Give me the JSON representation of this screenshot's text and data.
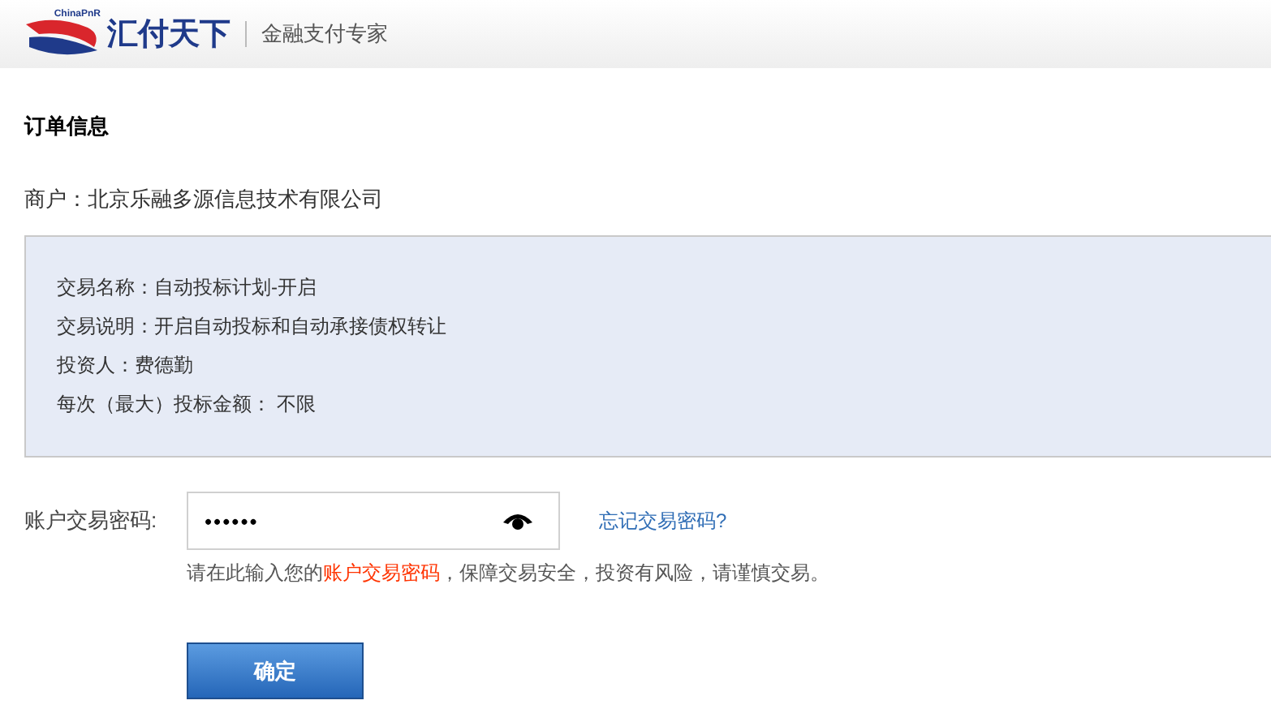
{
  "header": {
    "logo_small": "ChinaPnR",
    "brand": "汇付天下",
    "slogan": "金融支付专家"
  },
  "order": {
    "title": "订单信息",
    "merchant": "商户：北京乐融多源信息技术有限公司",
    "details": [
      "交易名称：自动投标计划-开启",
      "交易说明：开启自动投标和自动承接债权转让",
      "投资人：费德勤",
      "每次（最大）投标金额： 不限"
    ]
  },
  "password": {
    "label": "账户交易密码:",
    "value": "••••••",
    "forgot_link": "忘记交易密码?",
    "hint": [
      {
        "text": "请在此输入您的",
        "highlight": false
      },
      {
        "text": "账户交易密码",
        "highlight": true
      },
      {
        "text": "，保障交易安全，投资有风险，请谨慎交易。",
        "highlight": false
      }
    ]
  },
  "submit": "确定"
}
